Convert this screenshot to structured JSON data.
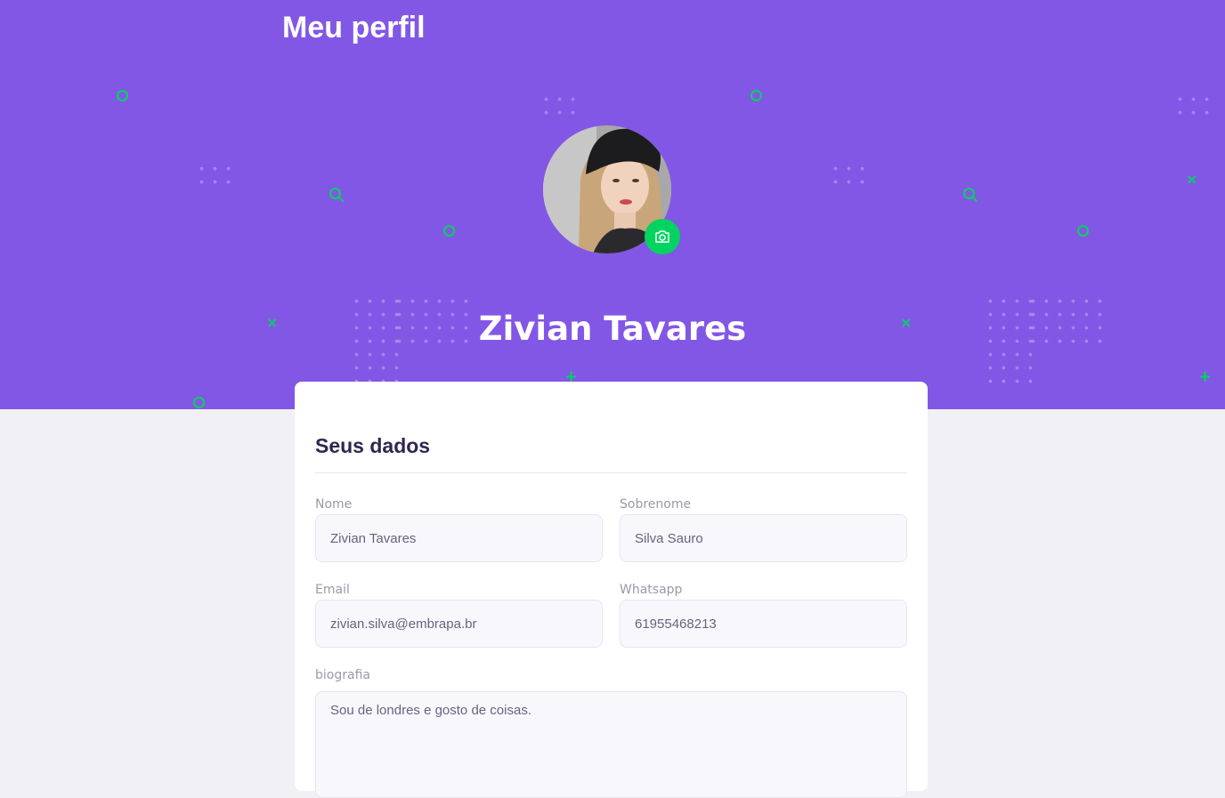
{
  "header": {
    "title": "Meu perfil",
    "accent_color": "#8257e5",
    "secondary_color": "#04d361"
  },
  "profile": {
    "name": "Zivian Tavares",
    "avatar_icon": "user-photo",
    "change_photo_icon": "camera-icon"
  },
  "form": {
    "section_title": "Seus dados",
    "fields": {
      "first_name": {
        "label": "Nome",
        "value": "Zivian Tavares"
      },
      "last_name": {
        "label": "Sobrenome",
        "value": "Silva Sauro"
      },
      "email": {
        "label": "Email",
        "value": "zivian.silva@embrapa.br"
      },
      "whatsapp": {
        "label": "Whatsapp",
        "value": "61955468213"
      },
      "bio": {
        "label": "biografia",
        "value": "Sou de londres e gosto de coisas."
      }
    }
  }
}
